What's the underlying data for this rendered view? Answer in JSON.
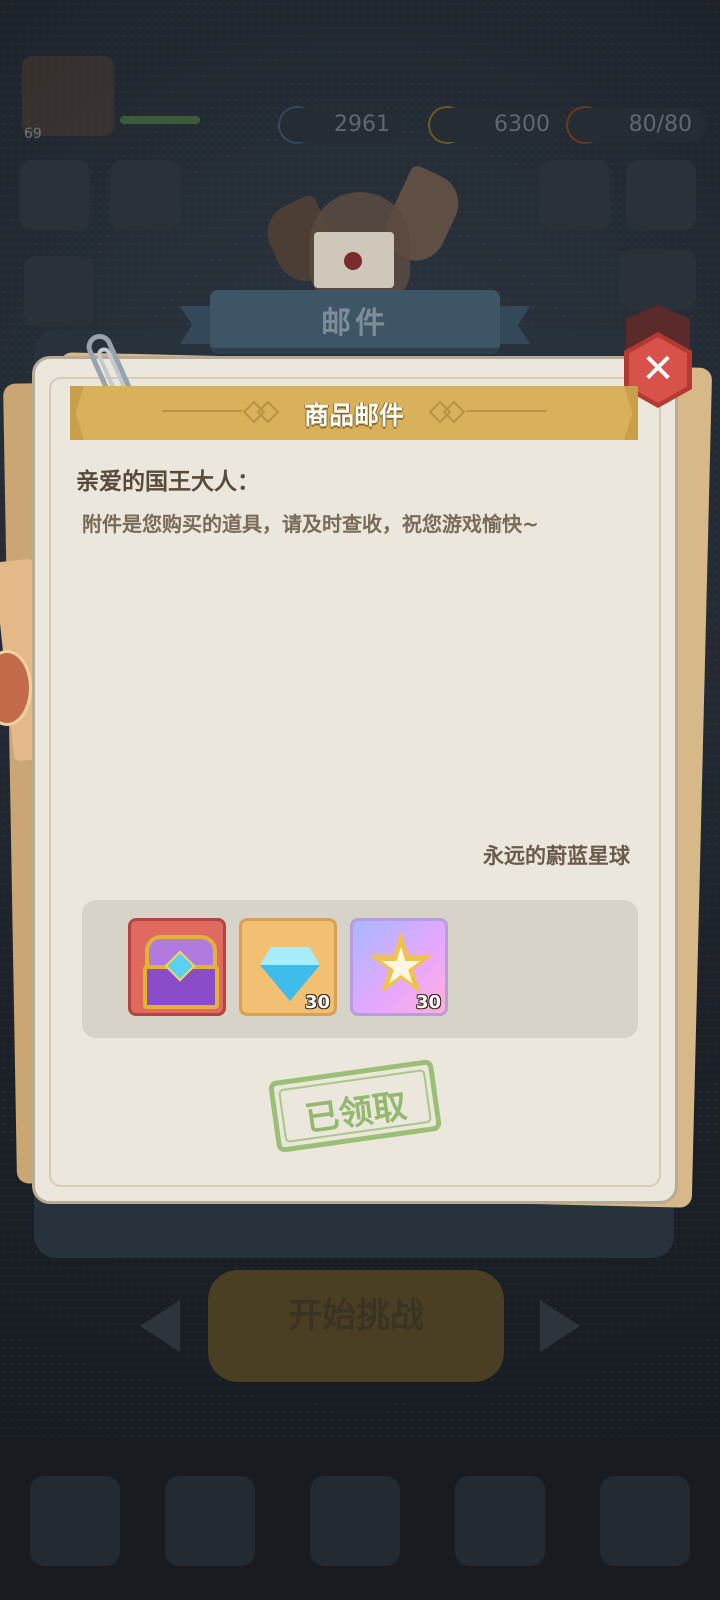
{
  "background": {
    "hud": {
      "level": "69",
      "resource_1": "2961",
      "resource_2": "6300",
      "resource_3": "80/80"
    },
    "start_button": "开始挑战"
  },
  "dialog": {
    "title": "邮件",
    "header": "商品邮件",
    "greeting": "亲爱的国王大人：",
    "body": "附件是您购买的道具，请及时查收，祝您游戏愉快~",
    "signature": "永远的蔚蓝星球",
    "close_icon": "close-icon",
    "attachments": [
      {
        "icon": "treasure-chest-icon",
        "count": ""
      },
      {
        "icon": "diamond-icon",
        "count": "30"
      },
      {
        "icon": "star-icon",
        "count": "30"
      }
    ],
    "claimed_stamp": "已领取"
  },
  "colors": {
    "paper": "#ebe7dc",
    "banner": "#d9b15a",
    "close": "#d9524a",
    "stamp": "#93b86e"
  }
}
